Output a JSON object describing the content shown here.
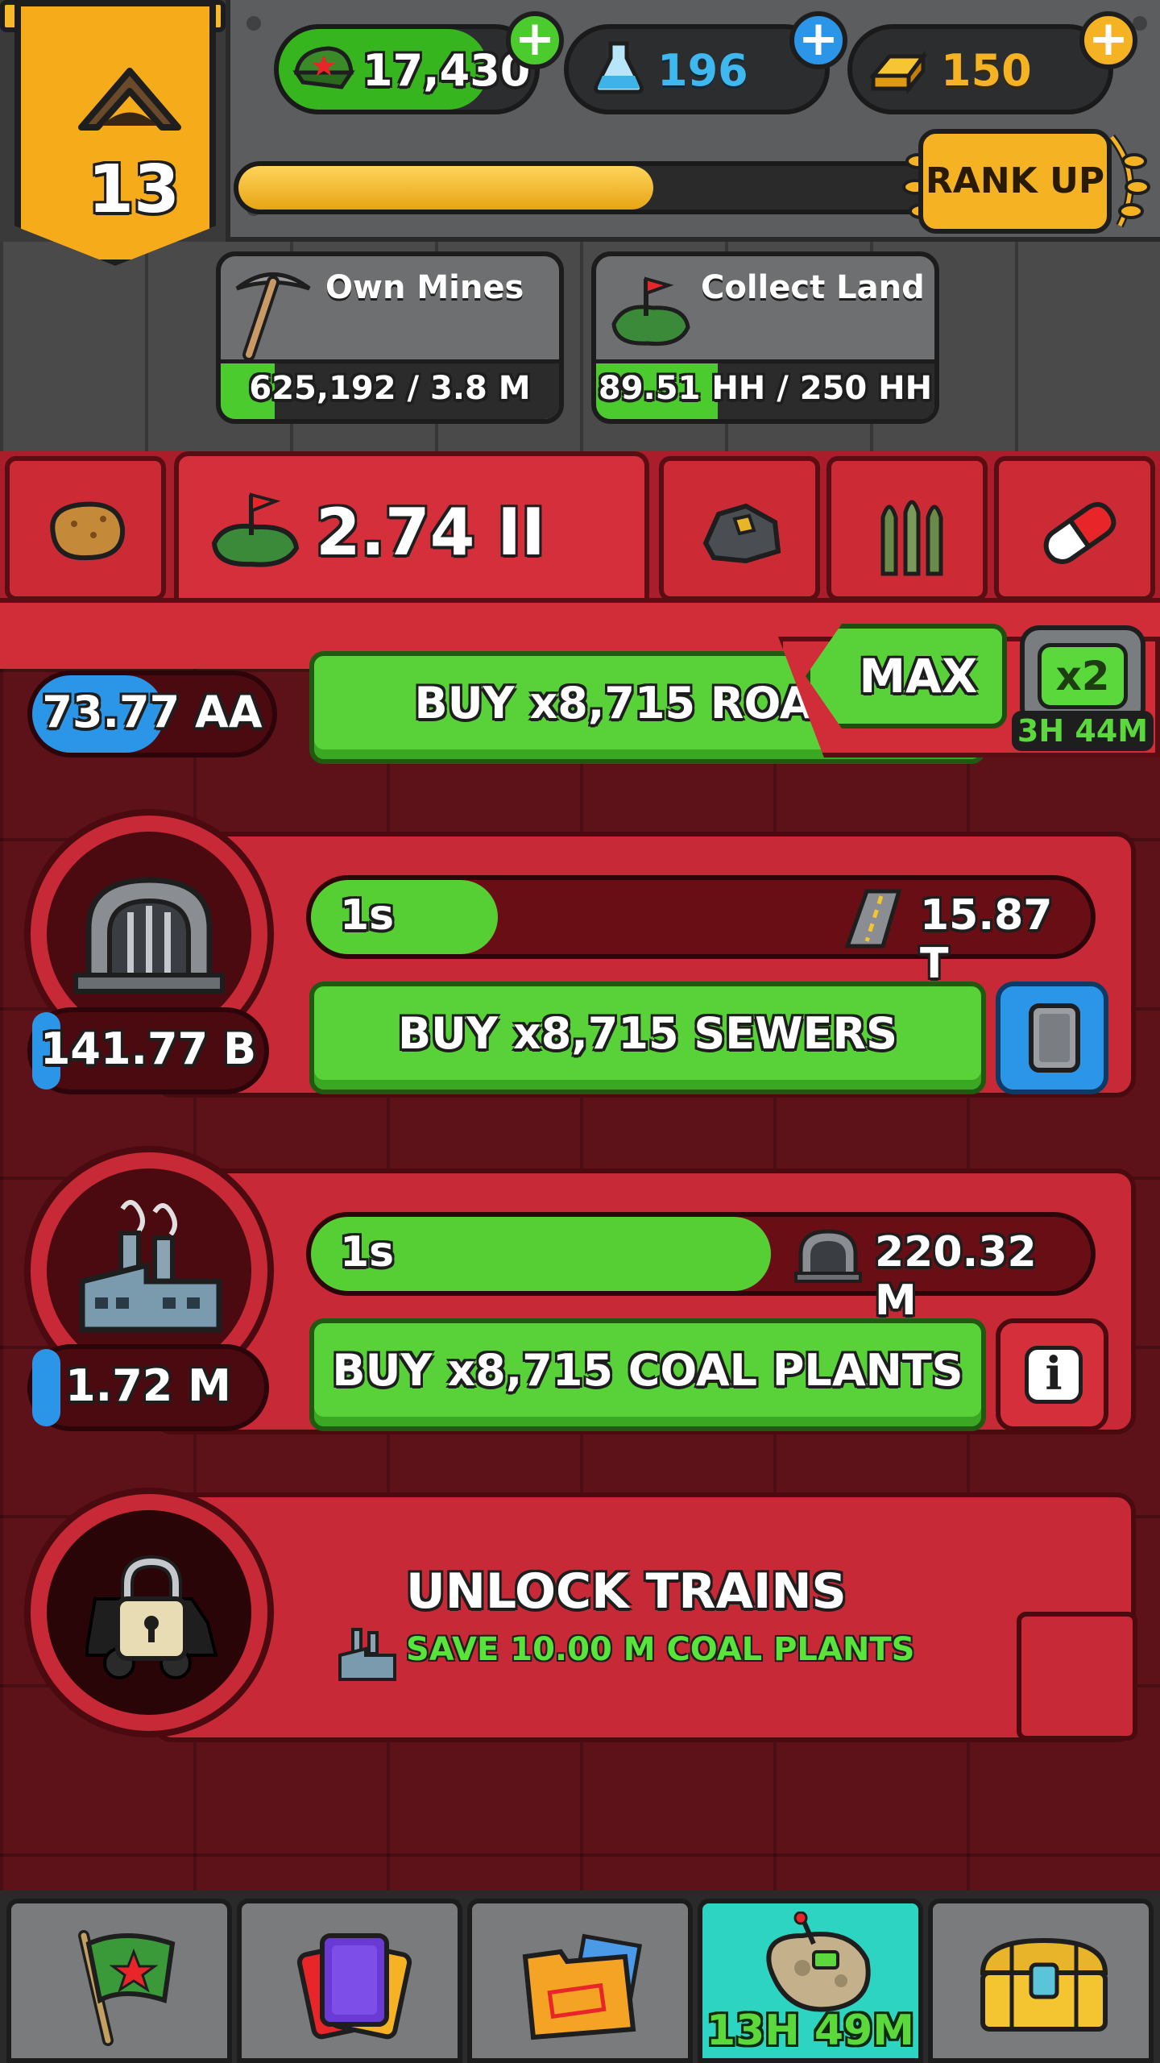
{
  "rank": {
    "level": "13"
  },
  "currencies": {
    "cash": {
      "value": "17,430",
      "icon": "army-cap-icon"
    },
    "science": {
      "value": "196",
      "icon": "flask-icon"
    },
    "gold": {
      "value": "150",
      "icon": "gold-bars-icon"
    }
  },
  "xp": {
    "progress": 0.58
  },
  "rank_up": {
    "label": "RANK UP"
  },
  "goals": [
    {
      "title": "Own Mines",
      "value": "625,192 / 3.8 M",
      "progress": 0.16,
      "icon": "pickaxe-icon"
    },
    {
      "title": "Collect Land",
      "value": "89.51 HH / 250 HH",
      "progress": 0.36,
      "icon": "land-flag-icon"
    }
  ],
  "resource_tabs": {
    "active_value": "2.74 II",
    "tabs": [
      "potato-icon",
      "land-flag-icon",
      "ore-rock-icon",
      "ammo-icon",
      "pill-icon"
    ]
  },
  "multiplier": {
    "label": "MAX"
  },
  "boost": {
    "label": "x2",
    "timer": "3H 44M"
  },
  "businesses": [
    {
      "name": "roads",
      "count": "73.77 AA",
      "count_fill": 0.55,
      "buy_label": "BUY x8,715 ROADS"
    },
    {
      "name": "sewers",
      "count": "141.77 B",
      "count_fill": 0.12,
      "time": "1s",
      "time_fill": 0.24,
      "income": "15.87 T",
      "income_icon": "road-icon",
      "buy_label": "BUY x8,715 SEWERS",
      "side_icon": "manager-card-icon"
    },
    {
      "name": "coal-plants",
      "count": "1.72 M",
      "count_fill": 0.12,
      "time": "1s",
      "time_fill": 0.59,
      "income": "220.32 M",
      "income_icon": "sewer-icon",
      "buy_label": "BUY x8,715 COAL PLANTS",
      "side_icon": "info-icon"
    }
  ],
  "unlock": {
    "title": "UNLOCK TRAINS",
    "condition": "SAVE 10.00 M COAL PLANTS"
  },
  "bottom_nav": {
    "items": [
      "flag-star-icon",
      "cards-icon",
      "folder-icon",
      "asteroid-icon",
      "treasure-chest-icon"
    ],
    "active_timer": "13H 49M"
  },
  "colors": {
    "accent_green": "#59d23a",
    "cash_green": "#4ccb2e",
    "science_blue": "#2b96e8",
    "gold": "#f5ab1a",
    "panel_red": "#c82936"
  }
}
